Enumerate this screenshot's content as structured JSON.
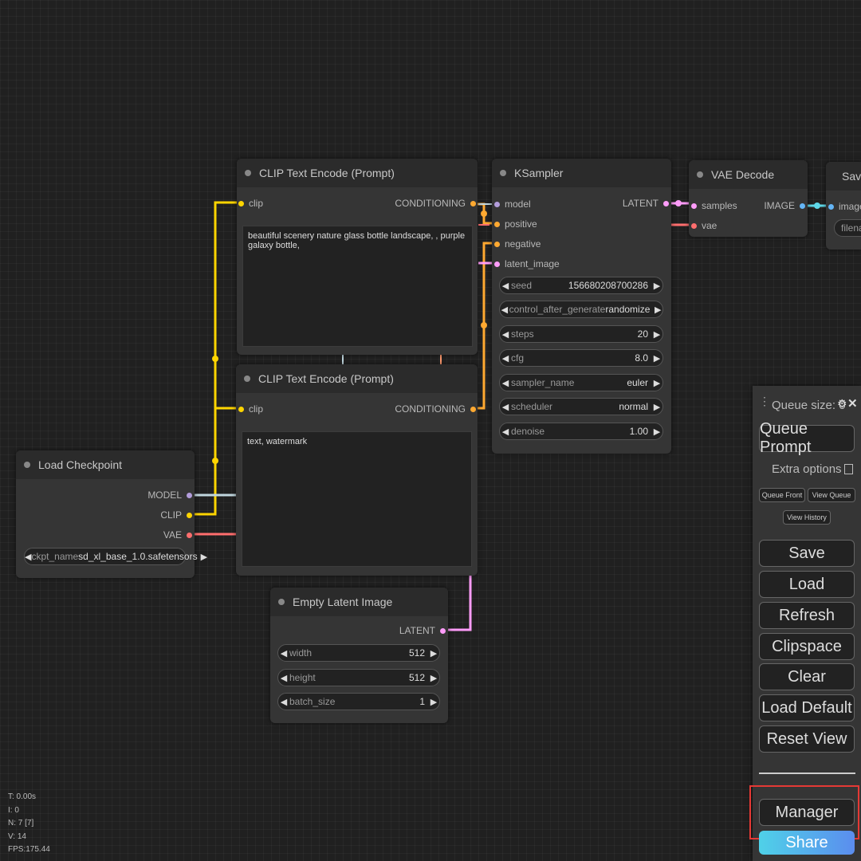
{
  "nodes": {
    "clip_pos": {
      "title": "CLIP Text Encode (Prompt)",
      "input_clip": "clip",
      "output": "CONDITIONING",
      "text": "beautiful scenery nature glass bottle landscape, , purple galaxy bottle,"
    },
    "clip_neg": {
      "title": "CLIP Text Encode (Prompt)",
      "input_clip": "clip",
      "output": "CONDITIONING",
      "text": "text, watermark"
    },
    "ksampler": {
      "title": "KSampler",
      "inputs": [
        "model",
        "positive",
        "negative",
        "latent_image"
      ],
      "output": "LATENT",
      "widgets": [
        {
          "label": "seed",
          "value": "156680208700286"
        },
        {
          "label": "control_after_generate",
          "value": "randomize"
        },
        {
          "label": "steps",
          "value": "20"
        },
        {
          "label": "cfg",
          "value": "8.0"
        },
        {
          "label": "sampler_name",
          "value": "euler"
        },
        {
          "label": "scheduler",
          "value": "normal"
        },
        {
          "label": "denoise",
          "value": "1.00"
        }
      ]
    },
    "vae_decode": {
      "title": "VAE Decode",
      "inputs": [
        "samples",
        "vae"
      ],
      "output": "IMAGE"
    },
    "save_image": {
      "title": "Save",
      "input": "images",
      "widget": "filenar"
    },
    "load_checkpoint": {
      "title": "Load Checkpoint",
      "outputs": [
        "MODEL",
        "CLIP",
        "VAE"
      ],
      "widget": {
        "label": "ckpt_name",
        "value": "sd_xl_base_1.0.safetensors"
      }
    },
    "empty_latent": {
      "title": "Empty Latent Image",
      "output": "LATENT",
      "widgets": [
        {
          "label": "width",
          "value": "512"
        },
        {
          "label": "height",
          "value": "512"
        },
        {
          "label": "batch_size",
          "value": "1"
        }
      ]
    }
  },
  "menu": {
    "queue_size": "Queue size: 0",
    "queue_prompt": "Queue Prompt",
    "extra_options": "Extra options",
    "queue_front": "Queue Front",
    "view_queue": "View Queue",
    "view_history": "View History",
    "save": "Save",
    "load": "Load",
    "refresh": "Refresh",
    "clipspace": "Clipspace",
    "clear": "Clear",
    "load_default": "Load Default",
    "reset_view": "Reset View",
    "manager": "Manager",
    "share": "Share"
  },
  "stats": {
    "t": "T: 0.00s",
    "i": "I: 0",
    "n": "N: 7 [7]",
    "v": "V: 14",
    "fps": "FPS:175.44"
  },
  "colors": {
    "clip": "#ffd500",
    "conditioning": "#ffa931",
    "latent": "#ff9cf9",
    "model": "#b39ddb",
    "vae": "#ff6e6e",
    "image": "#64b5f6",
    "highlight": "#e53935",
    "share_gradient": [
      "#4fd1e8",
      "#5b8dee"
    ]
  },
  "icons": {
    "settings": "gear-icon",
    "close": "close-icon",
    "drag": "drag-handle-icon"
  }
}
